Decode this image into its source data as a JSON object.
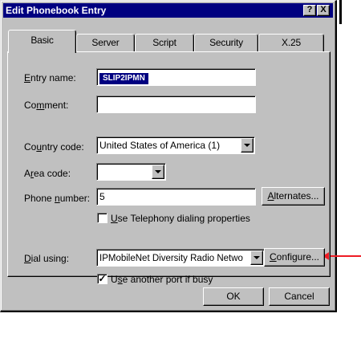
{
  "window": {
    "title": "Edit Phonebook Entry",
    "help_glyph": "?",
    "close_glyph": "X"
  },
  "tabs": [
    {
      "label": "Basic",
      "active": true
    },
    {
      "label": "Server",
      "active": false
    },
    {
      "label": "Script",
      "active": false
    },
    {
      "label": "Security",
      "active": false
    },
    {
      "label": "X.25",
      "active": false
    }
  ],
  "form": {
    "entry_name": {
      "label_pre": "",
      "label_ul": "E",
      "label_post": "ntry name:",
      "value": "SLIP2IPMN"
    },
    "comment": {
      "label_pre": "Co",
      "label_ul": "m",
      "label_post": "ment:",
      "value": ""
    },
    "country_code": {
      "label_pre": "Co",
      "label_ul": "u",
      "label_post": "ntry code:",
      "value": "United States of America (1)"
    },
    "area_code": {
      "label_pre": "A",
      "label_ul": "r",
      "label_post": "ea code:",
      "value": ""
    },
    "phone_number": {
      "label_pre": "Phone ",
      "label_ul": "n",
      "label_post": "umber:",
      "value": "5"
    },
    "alternates_button": {
      "label_pre": "",
      "label_ul": "A",
      "label_post": "lternates..."
    },
    "telephony_checkbox": {
      "checked": false,
      "label_pre": "",
      "label_ul": "U",
      "label_post": "se Telephony dialing properties"
    },
    "dial_using": {
      "label_pre": "",
      "label_ul": "D",
      "label_post": "ial using:",
      "value": "IPMobileNet Diversity Radio Netwo"
    },
    "configure_button": {
      "label_pre": "",
      "label_ul": "C",
      "label_post": "onfigure..."
    },
    "another_port_checkbox": {
      "checked": true,
      "label_pre": "U",
      "label_ul": "s",
      "label_post": "e another port if busy"
    }
  },
  "buttons": {
    "ok": "OK",
    "cancel": "Cancel"
  },
  "colors": {
    "titlebar": "#000080",
    "dialog": "#c0c0c0",
    "annotation_arrow": "#ee1c24"
  }
}
